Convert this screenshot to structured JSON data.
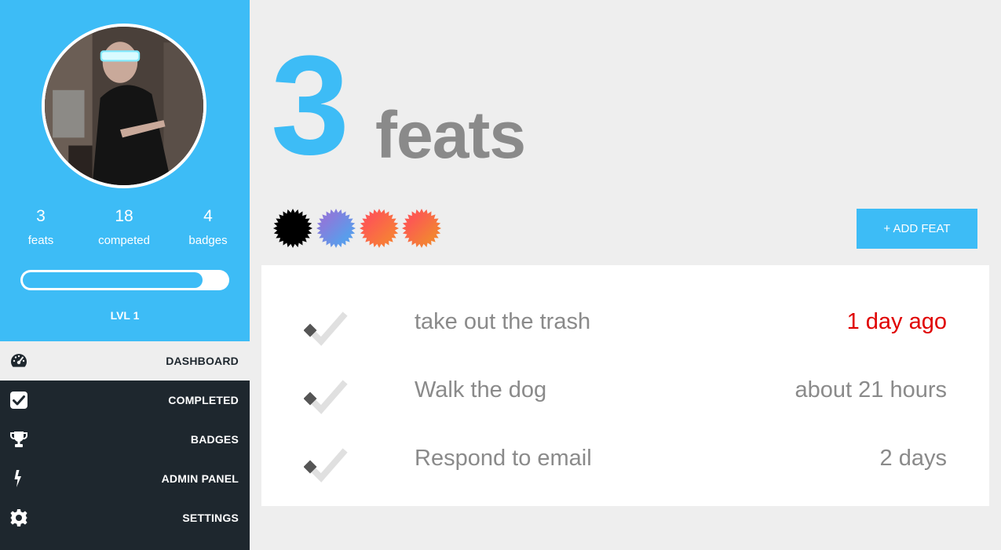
{
  "profile": {
    "stats": [
      {
        "value": "3",
        "label": "feats"
      },
      {
        "value": "18",
        "label": "competed"
      },
      {
        "value": "4",
        "label": "badges"
      }
    ],
    "level_progress": 0.88,
    "level_label": "LVL 1"
  },
  "nav": [
    {
      "label": "DASHBOARD",
      "icon": "dashboard-icon",
      "active": true
    },
    {
      "label": "COMPLETED",
      "icon": "checkbox-icon",
      "active": false
    },
    {
      "label": "BADGES",
      "icon": "trophy-icon",
      "active": false
    },
    {
      "label": "ADMIN PANEL",
      "icon": "bolt-icon",
      "active": false
    },
    {
      "label": "SETTINGS",
      "icon": "gear-icon",
      "active": false
    }
  ],
  "headline": {
    "count": "3",
    "word": "feats"
  },
  "badges": [
    {
      "name": "badge-black",
      "colors": [
        "#000000",
        "#000000"
      ]
    },
    {
      "name": "badge-purple-blue",
      "colors": [
        "#9b6fd6",
        "#4aa8f0"
      ]
    },
    {
      "name": "badge-red-orange",
      "colors": [
        "#ff4c5c",
        "#f5882f"
      ]
    },
    {
      "name": "badge-red-orange-2",
      "colors": [
        "#ff4c5c",
        "#f0902a"
      ]
    }
  ],
  "add_feat_label": "+ ADD FEAT",
  "feats": [
    {
      "title": "take out the trash",
      "time": "1 day ago",
      "overdue": true
    },
    {
      "title": "Walk the dog",
      "time": "about 21 hours",
      "overdue": false
    },
    {
      "title": "Respond to email",
      "time": "2 days",
      "overdue": false
    }
  ],
  "colors": {
    "accent": "#3dbcf6",
    "sidebar_dark": "#1e272e",
    "muted_text": "#8a8a8a",
    "overdue": "#e00000",
    "background": "#eeeeee"
  }
}
